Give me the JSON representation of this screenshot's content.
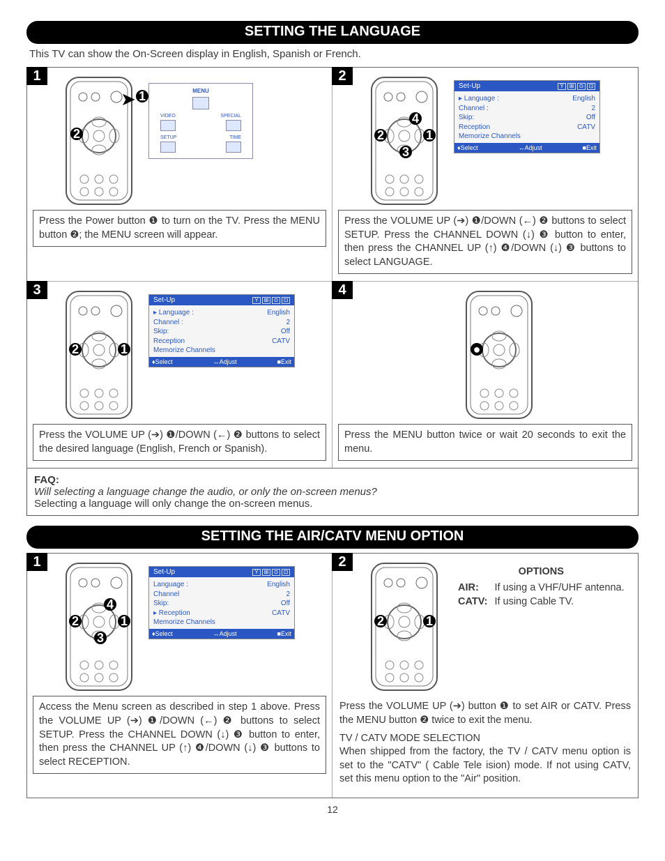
{
  "page_number": "12",
  "section1": {
    "title": "SETTING THE LANGUAGE",
    "intro": "This TV can show the On-Screen display in English, Spanish or French.",
    "steps": {
      "s1": {
        "num": "1",
        "text": "Press the Power button ❶ to turn on the TV. Press the MENU button ❷; the MENU screen will appear."
      },
      "s2": {
        "num": "2",
        "text": "Press the VOLUME UP (➔) ❶/DOWN (←) ❷ buttons to select SETUP. Press the CHANNEL DOWN (↓) ❸ button to enter, then press the CHANNEL UP (↑) ❹/DOWN (↓) ❸ buttons to select LANGUAGE."
      },
      "s3": {
        "num": "3",
        "text": "Press the VOLUME UP (➔) ❶/DOWN (←) ❷ buttons to select the desired language (English, French or Spanish)."
      },
      "s4": {
        "num": "4",
        "text": "Press the MENU button twice or wait 20 seconds to exit the menu."
      }
    },
    "menu_diagram": {
      "title": "MENU",
      "l1": "VIDEO",
      "l2": "SPECIAL",
      "l3": "SETUP",
      "l4": "TIME"
    },
    "osd": {
      "title": "Set-Up",
      "rows": {
        "r1a": "▸ Language :",
        "r1b": "English",
        "r2a": "Channel :",
        "r2b": "2",
        "r3a": "Skip:",
        "r3b": "Off",
        "r4a": "Reception",
        "r4b": "CATV",
        "r5a": "Memorize Channels"
      },
      "rows_step3": {
        "r1a": "▸ Language :",
        "r1b": "English",
        "r2a": "Channel :",
        "r2b": "2",
        "r3a": "Skip:",
        "r3b": "Off",
        "r4a": "Reception",
        "r4b": "CATV",
        "r5a": "Memorize Channels"
      },
      "foot": {
        "a": "♦Select",
        "b": "↔Adjust",
        "c": "■Exit"
      }
    },
    "faq": {
      "label": "FAQ:",
      "q": "Will selecting a language change the audio, or only the on-screen menus?",
      "a": "Selecting a language will only change the on-screen menus."
    }
  },
  "section2": {
    "title": "SETTING THE AIR/CATV MENU OPTION",
    "steps": {
      "s1": {
        "num": "1",
        "text": "Access the Menu screen as described in step 1 above. Press the VOLUME UP (➔) ❶/DOWN (←) ❷ buttons to select SETUP. Press the CHANNEL DOWN (↓) ❸ button to enter, then press the CHANNEL UP (↑) ❹/DOWN (↓) ❸ buttons to select RECEPTION."
      },
      "s2": {
        "num": "2",
        "text1": "Press the VOLUME UP (➔) button ❶ to set AIR or CATV. Press the MENU button ❷ twice to exit the menu.",
        "heading": "TV / CATV MODE SELECTION",
        "text2": "When shipped from the factory, the TV / CATV menu option  is set to the \"CATV\" ( Cable Tele  ision) mode. If not using CATV, set this menu option to the \"Air\" position."
      }
    },
    "osd": {
      "title": "Set-Up",
      "rows": {
        "r1a": "Language :",
        "r1b": "English",
        "r2a": "Channel",
        "r2b": "2",
        "r3a": "Skip:",
        "r3b": "Off",
        "r4a": "▸ Reception",
        "r4b": "CATV",
        "r5a": "Memorize Channels"
      },
      "foot": {
        "a": "♦Select",
        "b": "↔Adjust",
        "c": "■Exit"
      }
    },
    "options": {
      "heading": "OPTIONS",
      "air_label": "AIR:",
      "air_text": "If using a VHF/UHF antenna.",
      "catv_label": "CATV:",
      "catv_text": "If using Cable TV."
    }
  }
}
